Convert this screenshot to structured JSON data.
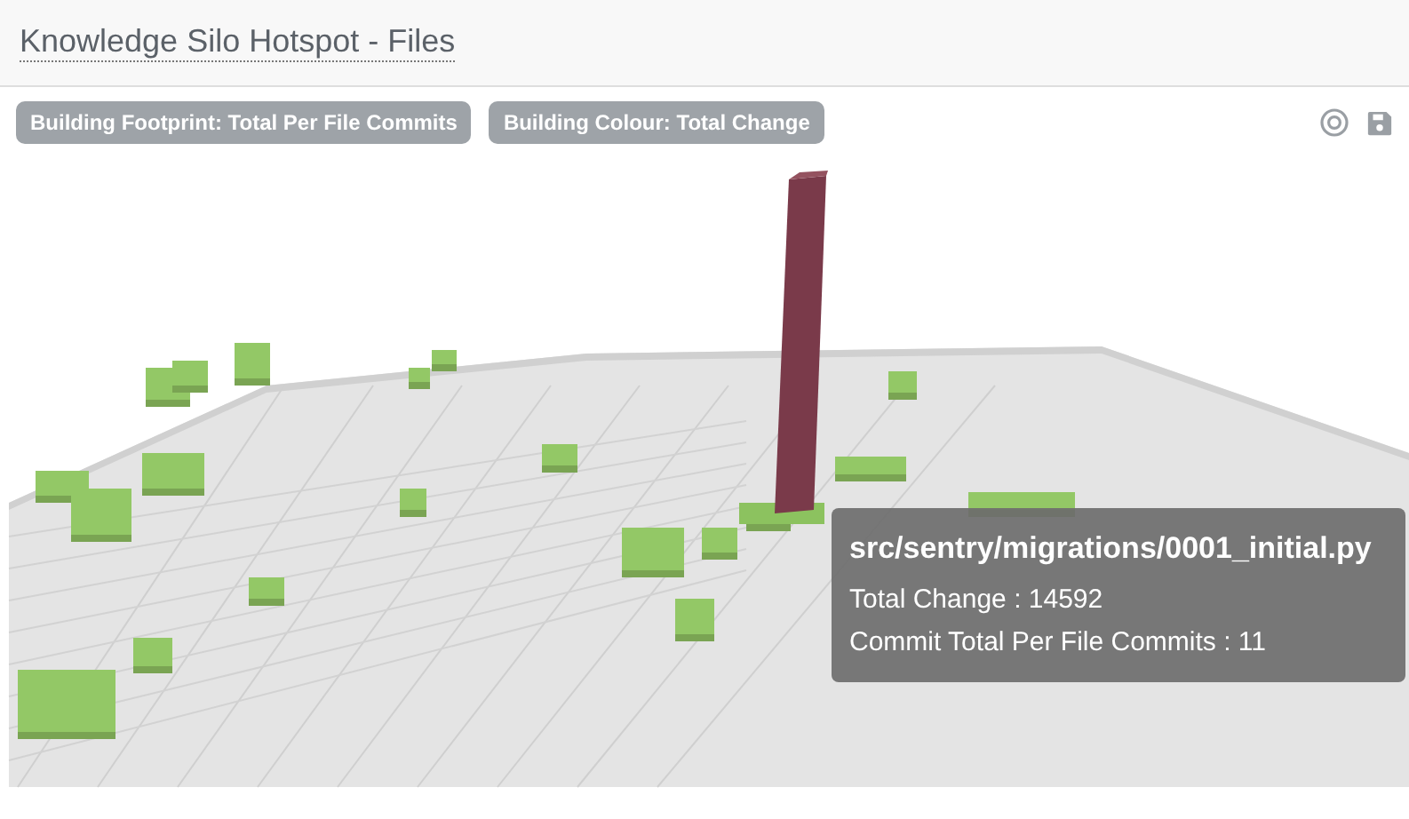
{
  "window": {
    "title": "Knowledge Silo Hotspot - Files"
  },
  "badges": [
    {
      "label": "Building Footprint: Total Per File Commits"
    },
    {
      "label": "Building Colour: Total Change"
    }
  ],
  "tooltip": {
    "title": "src/sentry/migrations/0001_initial.py",
    "lines": [
      "Total Change : 14592",
      "Commit Total Per File Commits : 11"
    ]
  }
}
